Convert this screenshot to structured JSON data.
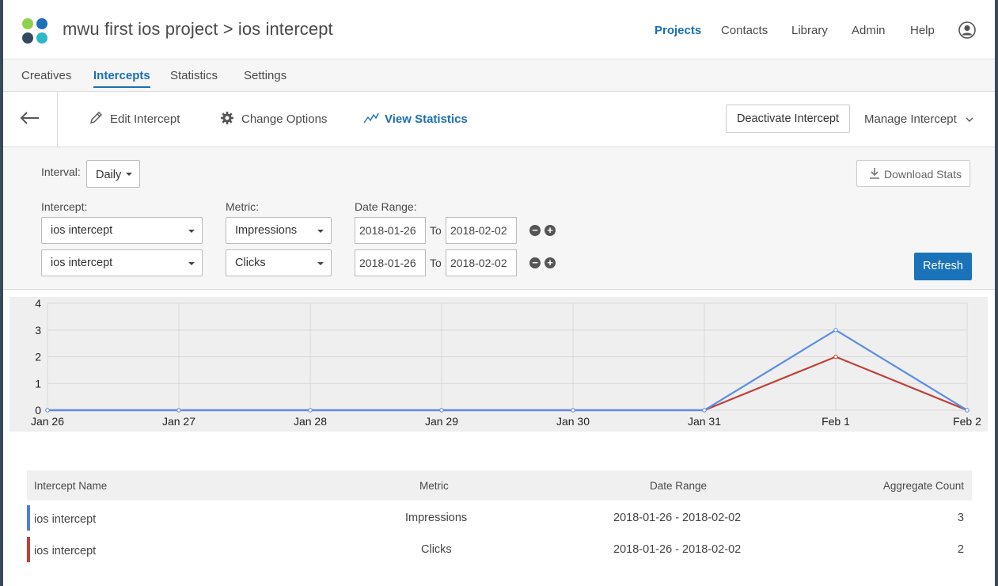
{
  "header": {
    "title": "mwu first ios project > ios intercept",
    "nav": [
      "Projects",
      "Contacts",
      "Library",
      "Admin",
      "Help"
    ],
    "active_nav": "Projects",
    "logo_colors": [
      "#8fd14f",
      "#1d6fb8",
      "#35495e",
      "#2bb8c7"
    ]
  },
  "tabs": [
    "Creatives",
    "Intercepts",
    "Statistics",
    "Settings"
  ],
  "active_tab": "Intercepts",
  "toolbar": {
    "edit": "Edit Intercept",
    "options": "Change Options",
    "stats": "View Statistics",
    "deactivate": "Deactivate Intercept",
    "manage": "Manage Intercept"
  },
  "filters": {
    "interval_label": "Interval:",
    "interval_value": "Daily",
    "download": "Download Stats",
    "intercept_label": "Intercept:",
    "metric_label": "Metric:",
    "date_range_label": "Date Range:",
    "to_label": "To",
    "rows": [
      {
        "intercept": "ios intercept",
        "metric": "Impressions",
        "from": "2018-01-26",
        "to": "2018-02-02"
      },
      {
        "intercept": "ios intercept",
        "metric": "Clicks",
        "from": "2018-01-26",
        "to": "2018-02-02"
      }
    ],
    "refresh": "Refresh"
  },
  "chart_data": {
    "type": "line",
    "categories": [
      "Jan 26",
      "Jan 27",
      "Jan 28",
      "Jan 29",
      "Jan 30",
      "Jan 31",
      "Feb 1",
      "Feb 2"
    ],
    "yticks": [
      "0",
      "1",
      "2",
      "3",
      "4"
    ],
    "ylim": [
      0,
      4
    ],
    "grid": true,
    "series": [
      {
        "metric": "Impressions",
        "color": "#5b8ee6",
        "values": [
          0,
          0,
          0,
          0,
          0,
          0,
          3,
          0
        ]
      },
      {
        "metric": "Clicks",
        "color": "#c0403a",
        "values": [
          0,
          0,
          0,
          0,
          0,
          0,
          2,
          0
        ]
      }
    ]
  },
  "table": {
    "headers": [
      "Intercept Name",
      "Metric",
      "Date Range",
      "Aggregate Count"
    ],
    "rows": [
      {
        "name": "ios intercept",
        "metric": "Impressions",
        "range": "2018-01-26 - 2018-02-02",
        "count": "3",
        "color": "#4a7fe0"
      },
      {
        "name": "ios intercept",
        "metric": "Clicks",
        "range": "2018-01-26 - 2018-02-02",
        "count": "2",
        "color": "#c0403a"
      }
    ]
  }
}
